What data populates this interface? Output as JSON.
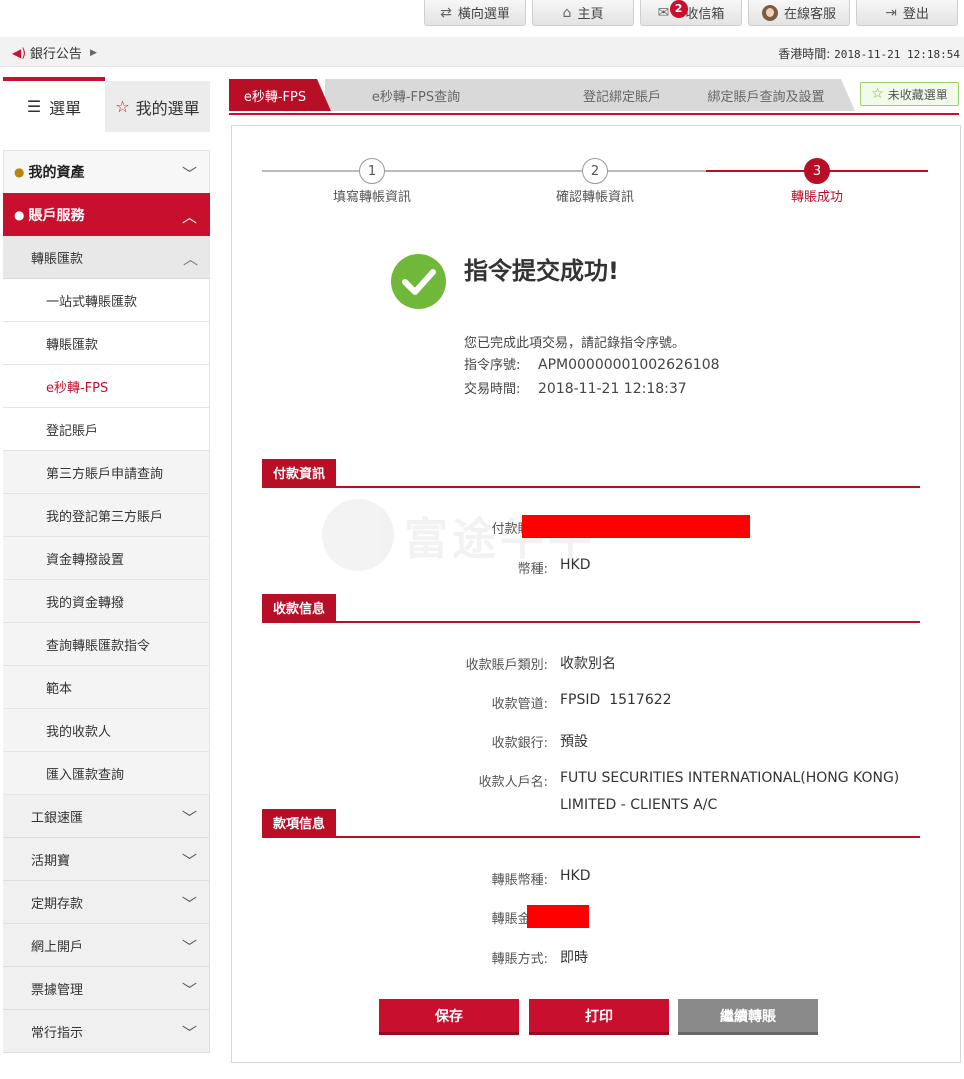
{
  "topbar": {
    "horizontal_menu": "橫向選單",
    "home": "主頁",
    "inbox": "收信箱",
    "inbox_count": "2",
    "online_service": "在線客服",
    "logout": "登出"
  },
  "announce": {
    "label": "銀行公告",
    "time_label": "香港時間:",
    "time_value": "2018-11-21 12:18:54"
  },
  "sidebar": {
    "tab_menu": "選單",
    "tab_my_menu": "我的選單",
    "sec_assets": "我的資產",
    "sec_account": "賬戶服務",
    "sub_transfer": "轉賬匯款",
    "items": [
      "一站式轉賬匯款",
      "轉賬匯款",
      "e秒轉-FPS",
      "登記賬戶",
      "第三方賬戶申請查詢",
      "我的登記第三方賬戶",
      "資金轉撥設置",
      "我的資金轉撥",
      "查詢轉賬匯款指令",
      "範本",
      "我的收款人",
      "匯入匯款查詢"
    ],
    "groups": [
      "工銀速匯",
      "活期寶",
      "定期存款",
      "網上開戶",
      "票據管理",
      "常行指示"
    ]
  },
  "tabs": {
    "t1": "e秒轉-FPS",
    "t2": "e秒轉-FPS查詢",
    "t3": "登記綁定賬戶",
    "t4": "綁定賬戶查詢及設置",
    "fav": "未收藏選單"
  },
  "steps": {
    "s1_num": "1",
    "s1_label": "填寫轉帳資訊",
    "s2_num": "2",
    "s2_label": "確認轉帳資訊",
    "s3_num": "3",
    "s3_label": "轉賬成功"
  },
  "result": {
    "title": "指令提交成功!",
    "note": "您已完成此項交易，請記錄指令序號。",
    "seq_label": "指令序號:",
    "seq_value": "APM00000001002626108",
    "time_label": "交易時間:",
    "time_value": "2018-11-21 12:18:37"
  },
  "payment": {
    "header": "付款資訊",
    "account_label": "付款賬號:",
    "currency_label": "幣種:",
    "currency_value": "HKD"
  },
  "receiver": {
    "header": "收款信息",
    "type_label": "收款賬戶類別:",
    "type_value": "收款別名",
    "channel_label": "收款管道:",
    "channel_value": "FPSID  1517622",
    "bank_label": "收款銀行:",
    "bank_value": "預設",
    "name_label": "收款人戶名:",
    "name_line1": "FUTU SECURITIES INTERNATIONAL(HONG KONG)",
    "name_line2": "LIMITED - CLIENTS A/C"
  },
  "funds": {
    "header": "款項信息",
    "currency_label": "轉賬幣種:",
    "currency_value": "HKD",
    "amount_label": "轉賬金額:",
    "mode_label": "轉賬方式:",
    "mode_value": "即時"
  },
  "buttons": {
    "save": "保存",
    "print": "打印",
    "continue": "繼續轉賬"
  },
  "watermark": "富途牛牛",
  "colors": {
    "brand_red": "#b80f27",
    "success_green": "#6fb83a",
    "redaction": "#ff0000"
  }
}
